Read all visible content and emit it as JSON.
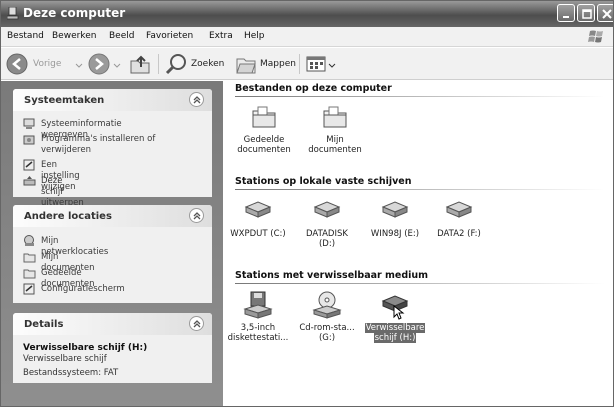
{
  "window": {
    "title": "Deze computer"
  },
  "menu": [
    "Bestand",
    "Bewerken",
    "Beeld",
    "Favorieten",
    "Extra",
    "Help"
  ],
  "toolbar": {
    "back": "Vorige",
    "search": "Zoeken",
    "folders": "Mappen"
  },
  "left": {
    "system_tasks": {
      "title": "Systeemtaken",
      "items": [
        "Systeeminformatie weergeven",
        "Programma's installeren of verwijderen",
        "Een instelling wijzigen",
        "Deze schijf uitwerpen"
      ]
    },
    "other_places": {
      "title": "Andere locaties",
      "items": [
        "Mijn netwerklocaties",
        "Mijn documenten",
        "Gedeelde documenten",
        "Configuratiescherm"
      ]
    },
    "details": {
      "title": "Details",
      "name": "Verwisselbare schijf (H:)",
      "type": "Verwisselbare schijf",
      "filesystem": "Bestandssysteem: FAT"
    }
  },
  "right": {
    "files_header": "Bestanden op deze computer",
    "files": [
      {
        "label1": "Gedeelde",
        "label2": "documenten"
      },
      {
        "label1": "Mijn",
        "label2": "documenten"
      }
    ],
    "hdd_header": "Stations op lokale vaste schijven",
    "drives": [
      {
        "label1": "WXPDUT (C:)",
        "label2": ""
      },
      {
        "label1": "DATADISK",
        "label2": "(D:)"
      },
      {
        "label1": "WIN98J (E:)",
        "label2": ""
      },
      {
        "label1": "DATA2 (F:)",
        "label2": ""
      }
    ],
    "removable_header": "Stations met verwisselbaar medium",
    "removable": [
      {
        "label1": "3,5-inch",
        "label2": "diskettestati..."
      },
      {
        "label1": "Cd-rom-sta...",
        "label2": "(G:)"
      },
      {
        "label1": "Verwisselbare",
        "label2": "schijf (H:)"
      }
    ]
  }
}
